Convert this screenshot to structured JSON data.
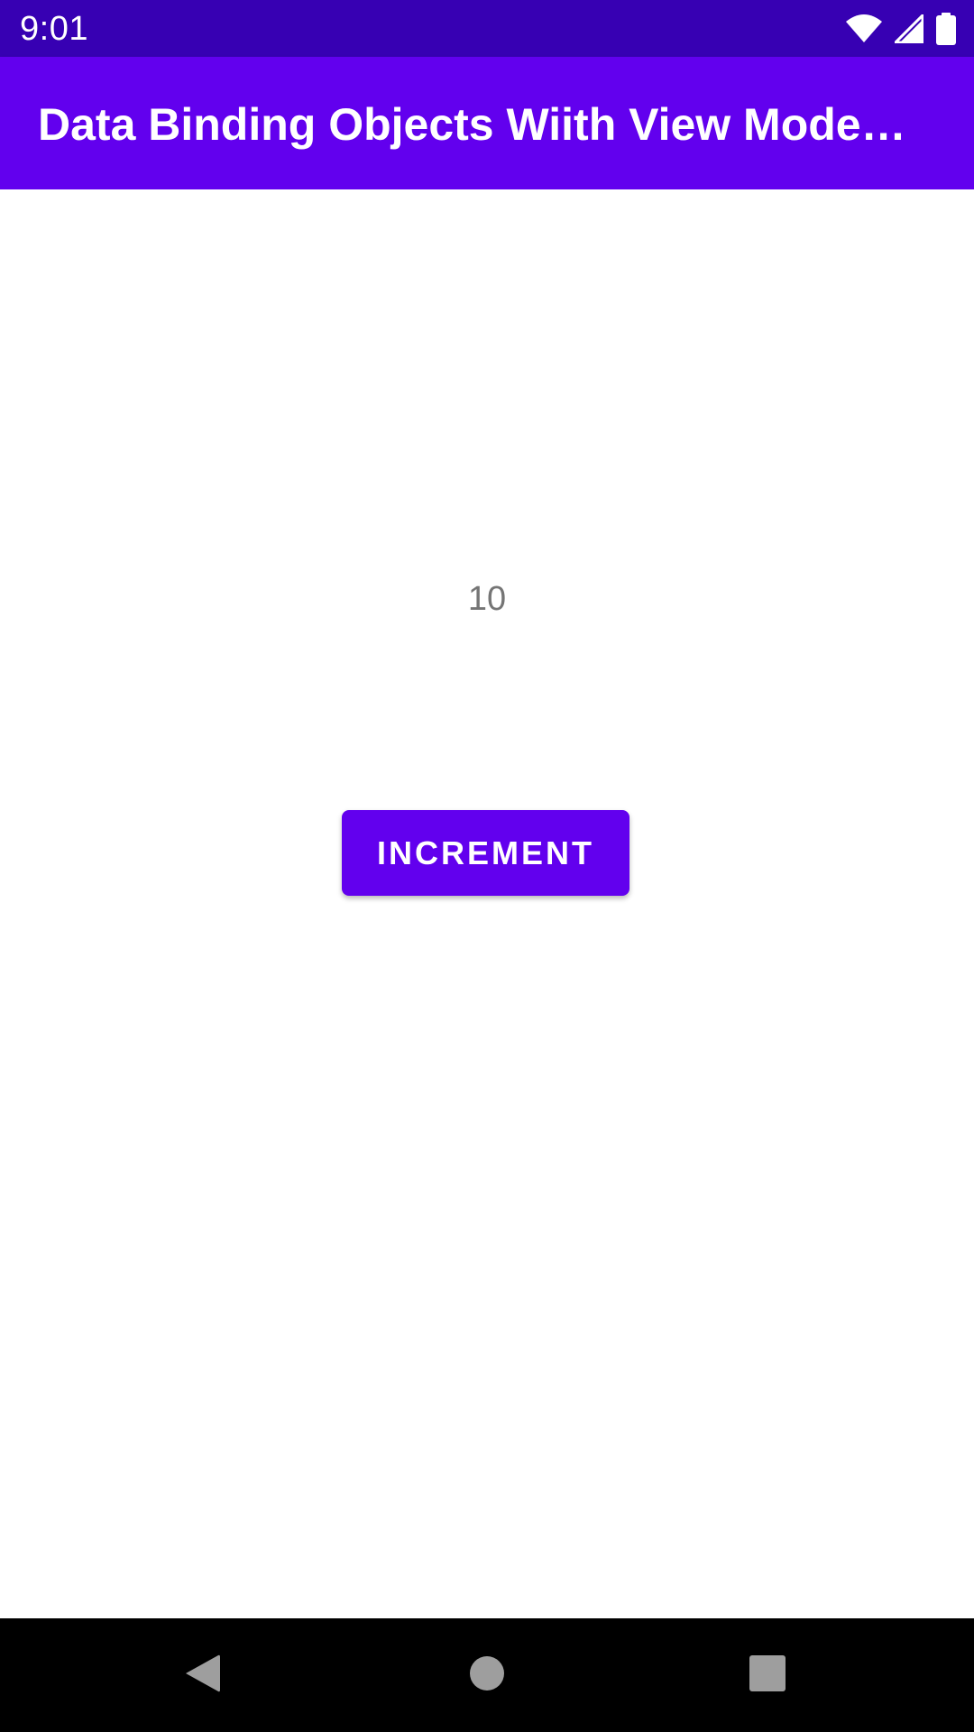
{
  "status_bar": {
    "time": "9:01",
    "icons": [
      "wifi-icon",
      "cellular-signal-icon",
      "battery-icon"
    ]
  },
  "app_bar": {
    "title": "Data Binding Objects Wiith View Mode…"
  },
  "main": {
    "counter_value": "10",
    "increment_label": "INCREMENT"
  },
  "nav_bar": {
    "icons": [
      "back-icon",
      "home-icon",
      "recents-icon"
    ]
  },
  "colors": {
    "status_bar": "#3700B3",
    "primary": "#6200EE",
    "counter_text": "#757575",
    "nav_bar": "#000000",
    "nav_icons": "#9E9E9E"
  }
}
